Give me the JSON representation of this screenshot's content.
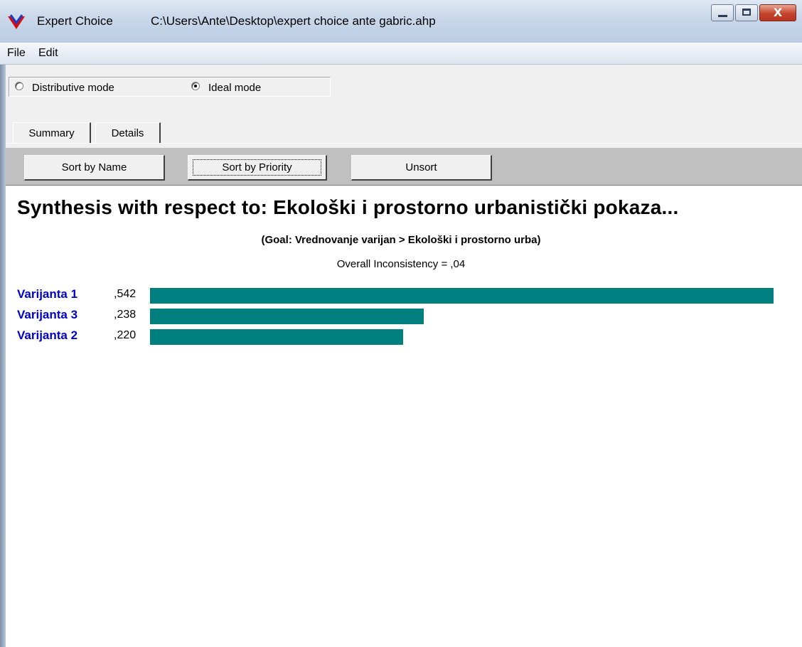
{
  "window": {
    "app_name": "Expert Choice",
    "file_path": "C:\\Users\\Ante\\Desktop\\expert choice ante gabric.ahp",
    "controls": {
      "minimize_glyph": "",
      "maximize_glyph": "",
      "close_glyph": "X"
    }
  },
  "menu": {
    "file": "File",
    "edit": "Edit"
  },
  "modes": {
    "distributive": {
      "label": "Distributive mode",
      "selected": false
    },
    "ideal": {
      "label": "Ideal mode",
      "selected": true
    }
  },
  "tabs": [
    {
      "label": "Summary",
      "active": true
    },
    {
      "label": "Details",
      "active": false
    }
  ],
  "toolbar": {
    "sort_name": "Sort by Name",
    "sort_priority": "Sort by Priority",
    "unsort": "Unsort"
  },
  "synthesis": {
    "title": "Synthesis with respect to: Ekološki i prostorno urbanistički pokaza...",
    "goal": "(Goal: Vrednovanje varijan > Ekološki i prostorno urba)",
    "inconsistency": "Overall Inconsistency = ,04"
  },
  "chart_data": {
    "type": "bar",
    "orientation": "horizontal",
    "categories": [
      "Varijanta 1",
      "Varijanta 3",
      "Varijanta 2"
    ],
    "values": [
      0.542,
      0.238,
      0.22
    ],
    "value_labels": [
      ",542",
      ",238",
      ",220"
    ],
    "bar_color": "#007f7f",
    "label_color": "#0000cc"
  },
  "colors": {
    "toolbar_bg": "#c0c0c0",
    "bar": "#007f7f"
  }
}
